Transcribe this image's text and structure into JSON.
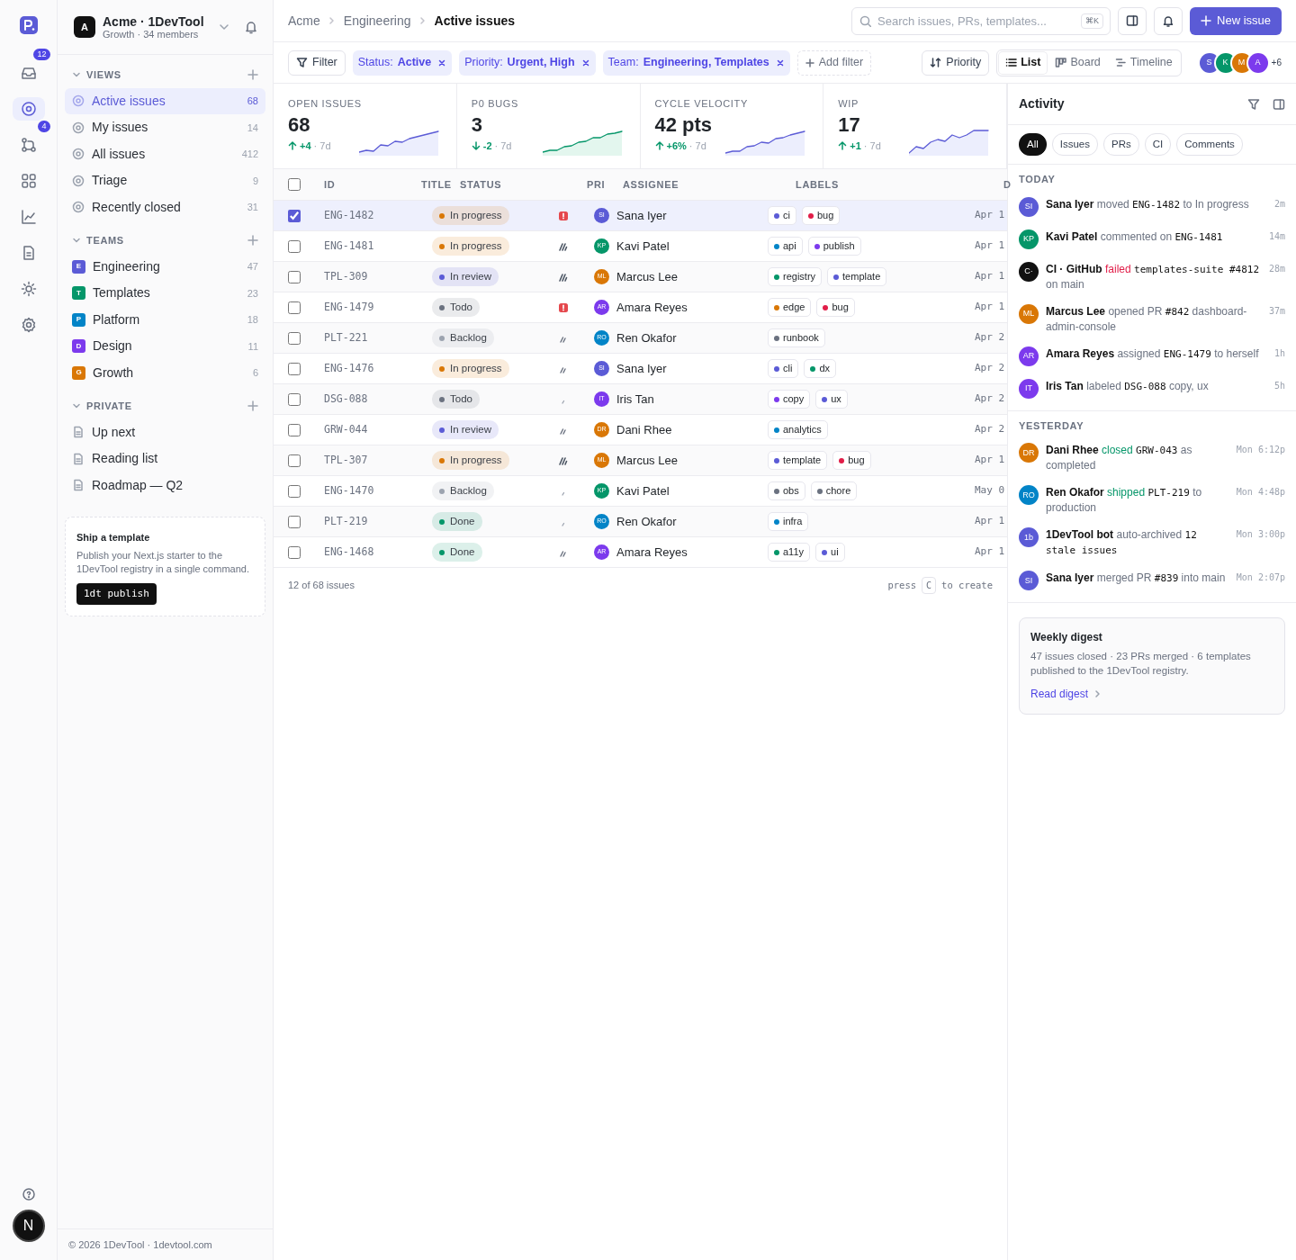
{
  "rail": {
    "items": [
      {
        "kind": "inbox",
        "badge": "12",
        "selected": false
      },
      {
        "kind": "issues",
        "selected": true
      },
      {
        "kind": "branch",
        "badge": "4",
        "selected": false
      },
      {
        "kind": "grid",
        "selected": false
      },
      {
        "kind": "chart",
        "selected": false
      },
      {
        "kind": "doc",
        "selected": false
      },
      {
        "kind": "sun",
        "selected": false
      },
      {
        "kind": "gear",
        "selected": false
      }
    ],
    "user_initial": "N"
  },
  "workspace": {
    "initial": "A",
    "name": "Acme · 1DevTool",
    "subtitle": "Growth · 34 members"
  },
  "sidebar": {
    "sections": [
      {
        "title": "VIEWS",
        "kind": "view",
        "items": [
          {
            "label": "Active issues",
            "count": "68",
            "selected": true
          },
          {
            "label": "My issues",
            "count": "14",
            "selected": false
          },
          {
            "label": "All issues",
            "count": "412",
            "selected": false
          },
          {
            "label": "Triage",
            "count": "9",
            "selected": false
          },
          {
            "label": "Recently closed",
            "count": "31",
            "selected": false
          }
        ]
      },
      {
        "title": "TEAMS",
        "kind": "team",
        "items": [
          {
            "initial": "E",
            "label": "Engineering",
            "count": "47",
            "color": "#5b5bd6",
            "selected": false
          },
          {
            "initial": "T",
            "label": "Templates",
            "count": "23",
            "color": "#059669",
            "selected": false
          },
          {
            "initial": "P",
            "label": "Platform",
            "count": "18",
            "color": "#0284c7",
            "selected": false
          },
          {
            "initial": "D",
            "label": "Design",
            "count": "11",
            "color": "#7c3aed",
            "selected": false
          },
          {
            "initial": "G",
            "label": "Growth",
            "count": "6",
            "color": "#d97706",
            "selected": false
          }
        ]
      },
      {
        "title": "PRIVATE",
        "kind": "doc",
        "items": [
          {
            "label": "Up next",
            "selected": false
          },
          {
            "label": "Reading list",
            "selected": false
          },
          {
            "label": "Roadmap — Q2",
            "selected": false
          }
        ]
      }
    ],
    "promo": {
      "title": "Ship a template",
      "text": "Publish your Next.js starter to the 1DevTool registry in a single command.",
      "command": "1dt publish"
    },
    "footer": "© 2026 1DevTool · 1devtool.com"
  },
  "breadcrumbs": [
    "Acme",
    "Engineering",
    "Active issues"
  ],
  "search": {
    "placeholder": "Search issues, PRs, templates...",
    "shortcut": "⌘K"
  },
  "new_button": "New issue",
  "filters": {
    "filter_button": "Filter",
    "chips": [
      {
        "key": "Status:",
        "value": "Active"
      },
      {
        "key": "Priority:",
        "value": "Urgent, High"
      },
      {
        "key": "Team:",
        "value": "Engineering, Templates"
      }
    ],
    "add": "Add filter",
    "sort": "Priority",
    "views": [
      {
        "label": "List",
        "kind": "list",
        "selected": true
      },
      {
        "label": "Board",
        "kind": "board",
        "selected": false
      },
      {
        "label": "Timeline",
        "kind": "timeline",
        "selected": false
      }
    ],
    "members": [
      {
        "initials": "S",
        "color": "#5b5bd6"
      },
      {
        "initials": "K",
        "color": "#059669"
      },
      {
        "initials": "M",
        "color": "#d97706"
      },
      {
        "initials": "A",
        "color": "#7c3aed"
      }
    ],
    "more": "+6"
  },
  "stats": [
    {
      "label": "OPEN ISSUES",
      "value": "68",
      "rising": true,
      "delta": "+4",
      "period": "· 7d"
    },
    {
      "label": "P0 BUGS",
      "value": "3",
      "rising": false,
      "delta": "-2",
      "period": "· 7d"
    },
    {
      "label": "CYCLE VELOCITY",
      "value": "42 pts",
      "rising": true,
      "delta": "+6%",
      "period": "· 7d"
    },
    {
      "label": "WIP",
      "value": "17",
      "rising": true,
      "delta": "+1",
      "period": "· 7d"
    }
  ],
  "table": {
    "header_checked": false,
    "columns": [
      "ID",
      "TITLE",
      "STATUS",
      "PRI",
      "ASSIGNEE",
      "LABELS",
      "D"
    ],
    "rows": [
      {
        "checked": true,
        "id": "ENG-1482",
        "status": "In progress",
        "color": "#d97706",
        "kind": "urgent",
        "assignee": {
          "initials": "SI",
          "name": "Sana Iyer",
          "color": "#5b5bd6"
        },
        "labels": [
          {
            "text": "ci",
            "color": "#5b5bd6"
          },
          {
            "text": "bug",
            "color": "#e11d48"
          }
        ],
        "date": "Apr 1"
      },
      {
        "checked": false,
        "id": "ENG-1481",
        "status": "In progress",
        "color": "#d97706",
        "kind": "high",
        "assignee": {
          "initials": "KP",
          "name": "Kavi Patel",
          "color": "#059669"
        },
        "labels": [
          {
            "text": "api",
            "color": "#0284c7"
          },
          {
            "text": "publish",
            "color": "#7c3aed"
          }
        ],
        "date": "Apr 1"
      },
      {
        "checked": false,
        "id": "TPL-309",
        "status": "In review",
        "color": "#5b5bd6",
        "kind": "high",
        "assignee": {
          "initials": "ML",
          "name": "Marcus Lee",
          "color": "#d97706"
        },
        "labels": [
          {
            "text": "registry",
            "color": "#059669"
          },
          {
            "text": "template",
            "color": "#5b5bd6"
          }
        ],
        "date": "Apr 1"
      },
      {
        "checked": false,
        "id": "ENG-1479",
        "status": "Todo",
        "color": "#6b7280",
        "kind": "urgent",
        "assignee": {
          "initials": "AR",
          "name": "Amara Reyes",
          "color": "#7c3aed"
        },
        "labels": [
          {
            "text": "edge",
            "color": "#d97706"
          },
          {
            "text": "bug",
            "color": "#e11d48"
          }
        ],
        "date": "Apr 1"
      },
      {
        "checked": false,
        "id": "PLT-221",
        "status": "Backlog",
        "color": "#9ca3af",
        "kind": "medium",
        "assignee": {
          "initials": "RO",
          "name": "Ren Okafor",
          "color": "#0284c7"
        },
        "labels": [
          {
            "text": "runbook",
            "color": "#6b7280"
          }
        ],
        "date": "Apr 2"
      },
      {
        "checked": false,
        "id": "ENG-1476",
        "status": "In progress",
        "color": "#d97706",
        "kind": "medium",
        "assignee": {
          "initials": "SI",
          "name": "Sana Iyer",
          "color": "#5b5bd6"
        },
        "labels": [
          {
            "text": "cli",
            "color": "#5b5bd6"
          },
          {
            "text": "dx",
            "color": "#059669"
          }
        ],
        "date": "Apr 2"
      },
      {
        "checked": false,
        "id": "DSG-088",
        "status": "Todo",
        "color": "#6b7280",
        "kind": "low",
        "assignee": {
          "initials": "IT",
          "name": "Iris Tan",
          "color": "#7c3aed"
        },
        "labels": [
          {
            "text": "copy",
            "color": "#7c3aed"
          },
          {
            "text": "ux",
            "color": "#5b5bd6"
          }
        ],
        "date": "Apr 2"
      },
      {
        "checked": false,
        "id": "GRW-044",
        "status": "In review",
        "color": "#5b5bd6",
        "kind": "medium",
        "assignee": {
          "initials": "DR",
          "name": "Dani Rhee",
          "color": "#d97706"
        },
        "labels": [
          {
            "text": "analytics",
            "color": "#0284c7"
          }
        ],
        "date": "Apr 2"
      },
      {
        "checked": false,
        "id": "TPL-307",
        "status": "In progress",
        "color": "#d97706",
        "kind": "high",
        "assignee": {
          "initials": "ML",
          "name": "Marcus Lee",
          "color": "#d97706"
        },
        "labels": [
          {
            "text": "template",
            "color": "#5b5bd6"
          },
          {
            "text": "bug",
            "color": "#e11d48"
          }
        ],
        "date": "Apr 1"
      },
      {
        "checked": false,
        "id": "ENG-1470",
        "status": "Backlog",
        "color": "#9ca3af",
        "kind": "low",
        "assignee": {
          "initials": "KP",
          "name": "Kavi Patel",
          "color": "#059669"
        },
        "labels": [
          {
            "text": "obs",
            "color": "#6b7280"
          },
          {
            "text": "chore",
            "color": "#6b7280"
          }
        ],
        "date": "May 0"
      },
      {
        "checked": false,
        "id": "PLT-219",
        "status": "Done",
        "color": "#059669",
        "kind": "low",
        "assignee": {
          "initials": "RO",
          "name": "Ren Okafor",
          "color": "#0284c7"
        },
        "labels": [
          {
            "text": "infra",
            "color": "#0284c7"
          }
        ],
        "date": "Apr 1"
      },
      {
        "checked": false,
        "id": "ENG-1468",
        "status": "Done",
        "color": "#059669",
        "kind": "medium",
        "assignee": {
          "initials": "AR",
          "name": "Amara Reyes",
          "color": "#7c3aed"
        },
        "labels": [
          {
            "text": "a11y",
            "color": "#059669"
          },
          {
            "text": "ui",
            "color": "#5b5bd6"
          }
        ],
        "date": "Apr 1"
      }
    ],
    "footer_count": "12 of 68 issues",
    "hint_before": "press",
    "hint_key": "C",
    "hint_after": "to create"
  },
  "activity": {
    "title": "Activity",
    "tabs": [
      {
        "label": "All",
        "selected": true
      },
      {
        "label": "Issues",
        "selected": false
      },
      {
        "label": "PRs",
        "selected": false
      },
      {
        "label": "CI",
        "selected": false
      },
      {
        "label": "Comments",
        "selected": false
      }
    ],
    "groups": [
      {
        "title": "TODAY",
        "items": [
          {
            "initials": "SI",
            "color": "#5b5bd6",
            "parts": [
              {
                "kind": "actor",
                "text": "Sana Iyer"
              },
              {
                "kind": "text",
                "text": "moved"
              },
              {
                "kind": "code",
                "text": "ENG-1482"
              },
              {
                "kind": "text",
                "text": "to In progress"
              }
            ],
            "time": "2m"
          },
          {
            "initials": "KP",
            "color": "#059669",
            "parts": [
              {
                "kind": "actor",
                "text": "Kavi Patel"
              },
              {
                "kind": "text",
                "text": "commented on"
              },
              {
                "kind": "code",
                "text": "ENG-1481"
              }
            ],
            "time": "14m"
          },
          {
            "initials": "C·",
            "color": "#111111",
            "parts": [
              {
                "kind": "actor",
                "text": "CI · GitHub"
              },
              {
                "kind": "failed",
                "text": "failed"
              },
              {
                "kind": "code",
                "text": "templates-suite #4812"
              },
              {
                "kind": "text",
                "text": "on main"
              }
            ],
            "time": "28m"
          },
          {
            "initials": "ML",
            "color": "#d97706",
            "parts": [
              {
                "kind": "actor",
                "text": "Marcus Lee"
              },
              {
                "kind": "text",
                "text": "opened PR"
              },
              {
                "kind": "code",
                "text": "#842"
              },
              {
                "kind": "text",
                "text": "dashboard-admin-console"
              }
            ],
            "time": "37m"
          },
          {
            "initials": "AR",
            "color": "#7c3aed",
            "parts": [
              {
                "kind": "actor",
                "text": "Amara Reyes"
              },
              {
                "kind": "text",
                "text": "assigned"
              },
              {
                "kind": "code",
                "text": "ENG-1479"
              },
              {
                "kind": "text",
                "text": "to herself"
              }
            ],
            "time": "1h"
          },
          {
            "initials": "IT",
            "color": "#7c3aed",
            "parts": [
              {
                "kind": "actor",
                "text": "Iris Tan"
              },
              {
                "kind": "text",
                "text": "labeled"
              },
              {
                "kind": "code",
                "text": "DSG-088"
              },
              {
                "kind": "text",
                "text": "copy, ux"
              }
            ],
            "time": "5h"
          }
        ]
      },
      {
        "title": "YESTERDAY",
        "items": [
          {
            "initials": "DR",
            "color": "#d97706",
            "parts": [
              {
                "kind": "actor",
                "text": "Dani Rhee"
              },
              {
                "kind": "success",
                "text": "closed"
              },
              {
                "kind": "code",
                "text": "GRW-043"
              },
              {
                "kind": "text",
                "text": "as completed"
              }
            ],
            "time": "Mon 6:12p"
          },
          {
            "initials": "RO",
            "color": "#0284c7",
            "parts": [
              {
                "kind": "actor",
                "text": "Ren Okafor"
              },
              {
                "kind": "success",
                "text": "shipped"
              },
              {
                "kind": "code",
                "text": "PLT-219"
              },
              {
                "kind": "text",
                "text": "to production"
              }
            ],
            "time": "Mon 4:48p"
          },
          {
            "initials": "1b",
            "color": "#5b5bd6",
            "parts": [
              {
                "kind": "actor",
                "text": "1DevTool bot"
              },
              {
                "kind": "text",
                "text": "auto-archived"
              },
              {
                "kind": "code",
                "text": "12 stale issues"
              }
            ],
            "time": "Mon 3:00p"
          },
          {
            "initials": "SI",
            "color": "#5b5bd6",
            "parts": [
              {
                "kind": "actor",
                "text": "Sana Iyer"
              },
              {
                "kind": "text",
                "text": "merged PR"
              },
              {
                "kind": "code",
                "text": "#839"
              },
              {
                "kind": "text",
                "text": "into main"
              }
            ],
            "time": "Mon 2:07p"
          }
        ]
      }
    ],
    "digest": {
      "title": "Weekly digest",
      "text": "47 issues closed · 23 PRs merged · 6 templates published to the 1DevTool registry.",
      "link": "Read digest"
    }
  }
}
